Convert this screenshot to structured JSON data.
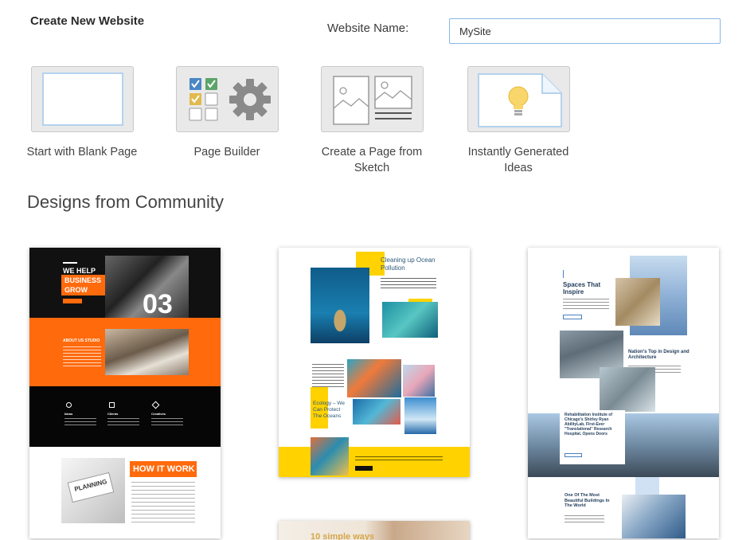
{
  "header": {
    "title": "Create New Website",
    "name_label": "Website Name:",
    "name_value": "MySite"
  },
  "options": [
    {
      "label": "Start with Blank Page"
    },
    {
      "label": "Page Builder"
    },
    {
      "label": "Create a Page from Sketch"
    },
    {
      "label": "Instantly Generated Ideas"
    }
  ],
  "community": {
    "title": "Designs from Community",
    "designs": [
      {
        "hero_line1": "WE HELP",
        "hero_line2": "BUSINESS",
        "hero_line3": "GROW",
        "big_number": "03",
        "about_heading": "ABOUT US STUDIO",
        "feature_1": "Ideas",
        "feature_2": "Clients",
        "feature_3": "Creatives",
        "how_heading": "HOW IT WORK",
        "planning": "PLANNING"
      },
      {
        "title": "Cleaning up Ocean Pollution",
        "ecology_text": "Ecology – We Can Protect The Oceans"
      },
      {
        "heading_1": "Spaces That Inspire",
        "heading_2": "Nation's Top in Design and Architecture",
        "heading_3": "Rehabilitation Institute of Chicago's Shirley Ryan AbilityLab, First-Ever \"Translational\" Research Hospital, Opens Doors",
        "heading_4": "One Of The Most Beautiful Buildings In The World"
      },
      {
        "title": "10 simple ways"
      }
    ]
  },
  "colors": {
    "accent_orange": "#ff6a0d",
    "accent_yellow": "#ffd200",
    "input_border": "#8ab6e6"
  }
}
